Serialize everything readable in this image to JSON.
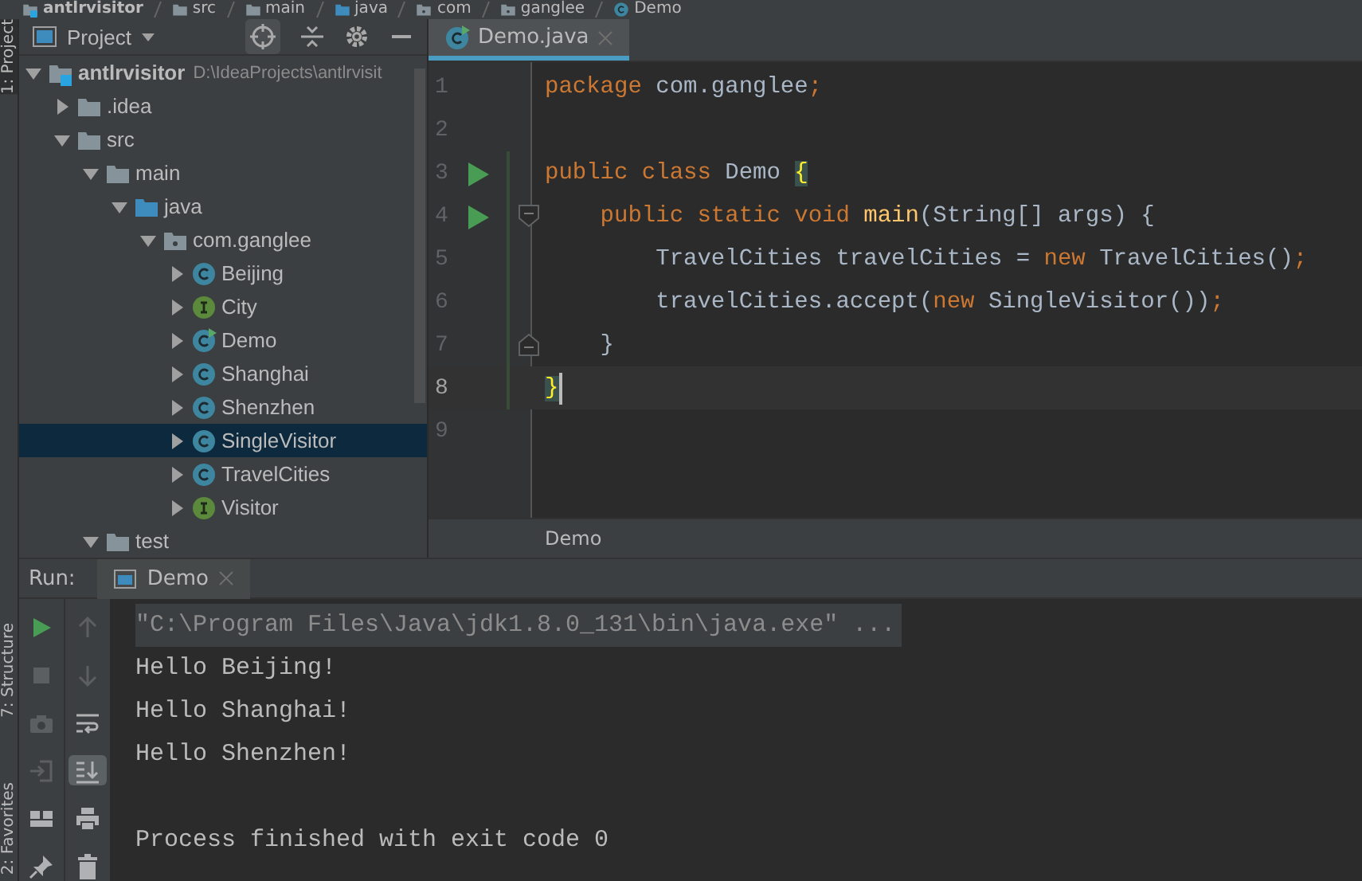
{
  "breadcrumb": [
    {
      "label": "antlrvisitor",
      "kind": "module"
    },
    {
      "label": "src",
      "kind": "folder"
    },
    {
      "label": "main",
      "kind": "folder"
    },
    {
      "label": "java",
      "kind": "source"
    },
    {
      "label": "com",
      "kind": "package"
    },
    {
      "label": "ganglee",
      "kind": "package"
    },
    {
      "label": "Demo",
      "kind": "class"
    }
  ],
  "side_stripe": {
    "top": [
      {
        "label": "1: Project",
        "selected": true
      }
    ],
    "bottom": [
      {
        "label": "7: Structure",
        "selected": false
      },
      {
        "label": "2: Favorites",
        "selected": false
      }
    ]
  },
  "project": {
    "title": "Project",
    "tree": [
      {
        "label": "antlrvisitor",
        "path": "D:\\IdeaProjects\\antlrvisit",
        "kind": "module",
        "expanded": true,
        "selected": false,
        "children": [
          {
            "label": ".idea",
            "kind": "folder",
            "expanded": false,
            "selected": false
          },
          {
            "label": "src",
            "kind": "folder",
            "expanded": true,
            "selected": false,
            "children": [
              {
                "label": "main",
                "kind": "folder",
                "expanded": true,
                "selected": false,
                "children": [
                  {
                    "label": "java",
                    "kind": "source",
                    "expanded": true,
                    "selected": false,
                    "children": [
                      {
                        "label": "com.ganglee",
                        "kind": "package",
                        "expanded": true,
                        "selected": false,
                        "children": [
                          {
                            "label": "Beijing",
                            "kind": "class",
                            "expanded": false,
                            "selected": false
                          },
                          {
                            "label": "City",
                            "kind": "interface",
                            "expanded": false,
                            "selected": false
                          },
                          {
                            "label": "Demo",
                            "kind": "runnable",
                            "expanded": false,
                            "selected": false
                          },
                          {
                            "label": "Shanghai",
                            "kind": "class",
                            "expanded": false,
                            "selected": false
                          },
                          {
                            "label": "Shenzhen",
                            "kind": "class",
                            "expanded": false,
                            "selected": false
                          },
                          {
                            "label": "SingleVisitor",
                            "kind": "class",
                            "expanded": false,
                            "selected": true
                          },
                          {
                            "label": "TravelCities",
                            "kind": "class",
                            "expanded": false,
                            "selected": false
                          },
                          {
                            "label": "Visitor",
                            "kind": "interface",
                            "expanded": false,
                            "selected": false
                          }
                        ]
                      }
                    ]
                  }
                ]
              },
              {
                "label": "test",
                "kind": "folder",
                "expanded": true,
                "selected": false
              }
            ]
          }
        ]
      }
    ]
  },
  "editor": {
    "tabs": [
      {
        "label": "Demo.java",
        "selected": true
      }
    ],
    "lines": [
      {
        "number": "1",
        "run": false,
        "fold_start": false,
        "fold_end": false,
        "changed": false,
        "current": false,
        "tokens": [
          {
            "kind": "kw",
            "text": "package"
          },
          {
            "kind": "plain",
            "text": " com.ganglee"
          },
          {
            "kind": "kw",
            "text": ";"
          }
        ]
      },
      {
        "number": "2",
        "run": false,
        "fold_start": false,
        "fold_end": false,
        "changed": false,
        "current": false
      },
      {
        "number": "3",
        "run": true,
        "fold_start": false,
        "fold_end": false,
        "changed": true,
        "current": false,
        "tokens": [
          {
            "kind": "kw",
            "text": "public class"
          },
          {
            "kind": "plain",
            "text": " Demo "
          },
          {
            "kind": "match",
            "text": "{"
          }
        ]
      },
      {
        "number": "4",
        "run": true,
        "fold_start": true,
        "fold_end": false,
        "changed": true,
        "current": false,
        "tokens": [
          {
            "kind": "kw",
            "text": "    public static void"
          },
          {
            "kind": "method",
            "text": " main"
          },
          {
            "kind": "plain",
            "text": "(String[] args) {"
          }
        ]
      },
      {
        "number": "5",
        "run": false,
        "fold_start": false,
        "fold_end": false,
        "changed": true,
        "current": false,
        "tokens": [
          {
            "kind": "plain",
            "text": "        TravelCities travelCities = "
          },
          {
            "kind": "kw",
            "text": "new"
          },
          {
            "kind": "plain",
            "text": " TravelCities()"
          },
          {
            "kind": "kw",
            "text": ";"
          }
        ]
      },
      {
        "number": "6",
        "run": false,
        "fold_start": false,
        "fold_end": false,
        "changed": true,
        "current": false,
        "tokens": [
          {
            "kind": "plain",
            "text": "        travelCities.accept("
          },
          {
            "kind": "kw",
            "text": "new"
          },
          {
            "kind": "plain",
            "text": " SingleVisitor())"
          },
          {
            "kind": "kw",
            "text": ";"
          }
        ]
      },
      {
        "number": "7",
        "run": false,
        "fold_start": false,
        "fold_end": true,
        "changed": true,
        "current": false,
        "tokens": [
          {
            "kind": "plain",
            "text": "    }"
          }
        ]
      },
      {
        "number": "8",
        "run": false,
        "fold_start": false,
        "fold_end": false,
        "changed": true,
        "current": true,
        "tokens": [
          {
            "kind": "match",
            "text": "}"
          }
        ]
      },
      {
        "number": "9",
        "run": false,
        "fold_start": false,
        "fold_end": false,
        "changed": false,
        "current": false
      }
    ],
    "footer": "Demo"
  },
  "run": {
    "label": "Run:",
    "tabs": [
      {
        "label": "Demo",
        "selected": true
      }
    ],
    "left_toolbar": [
      {
        "kind": "run",
        "disabled": false
      },
      {
        "kind": "stop",
        "disabled": true
      },
      {
        "kind": "camera",
        "disabled": true
      },
      {
        "kind": "exit",
        "disabled": true
      },
      {
        "kind": "layout",
        "disabled": false
      },
      {
        "kind": "pin",
        "disabled": false
      }
    ],
    "right_toolbar": [
      {
        "kind": "up",
        "disabled": true,
        "on": false
      },
      {
        "kind": "down",
        "disabled": true,
        "on": false
      },
      {
        "kind": "wrap",
        "disabled": false,
        "on": false
      },
      {
        "kind": "scroll-end",
        "disabled": false,
        "on": true
      },
      {
        "kind": "print",
        "disabled": false,
        "on": false
      },
      {
        "kind": "trash",
        "disabled": false,
        "on": false
      }
    ],
    "console": [
      {
        "kind": "command",
        "text": "\"C:\\Program Files\\Java\\jdk1.8.0_131\\bin\\java.exe\" ..."
      },
      {
        "kind": "output",
        "text": "Hello Beijing!"
      },
      {
        "kind": "output",
        "text": "Hello Shanghai!"
      },
      {
        "kind": "output",
        "text": "Hello Shenzhen!"
      },
      {
        "kind": "blank"
      },
      {
        "kind": "output",
        "text": "Process finished with exit code 0"
      }
    ]
  }
}
